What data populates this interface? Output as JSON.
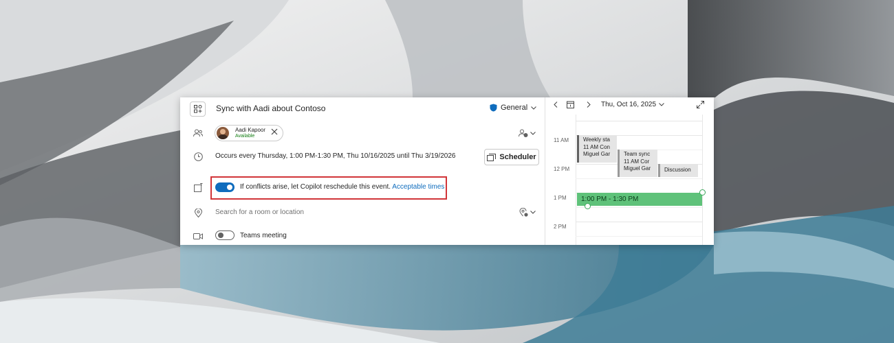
{
  "event": {
    "title": "Sync with Aadi about Contoso",
    "category": "General",
    "colors": {
      "accent": "#0f6cbd",
      "highlight_border": "#d13438",
      "new_event": "#5fc27a",
      "available": "#107c10"
    }
  },
  "attendee": {
    "name": "Aadi Kapoor",
    "status": "Available"
  },
  "recurrence": {
    "text": "Occurs every Thursday, 1:00 PM-1:30 PM, Thu 10/16/2025 until Thu 3/19/2026"
  },
  "scheduler_label": "Scheduler",
  "copilot": {
    "enabled": true,
    "text": "If conflicts arise, let Copilot reschedule this event.",
    "link": "Acceptable times"
  },
  "location": {
    "placeholder": "Search for a room or location"
  },
  "teams": {
    "enabled": false,
    "label": "Teams meeting"
  },
  "calendar": {
    "date_label": "Thu, Oct 16, 2025",
    "hours": [
      "11 AM",
      "12 PM",
      "1 PM",
      "2 PM"
    ],
    "events": [
      {
        "title": "Weekly sta",
        "time": "11 AM Con",
        "person": "Miguel Gar"
      },
      {
        "title": "Team sync",
        "time": "11 AM Cor",
        "person": "Miguel Gar"
      },
      {
        "title": "Discussion"
      }
    ],
    "new_event_label": "1:00 PM - 1:30 PM"
  }
}
